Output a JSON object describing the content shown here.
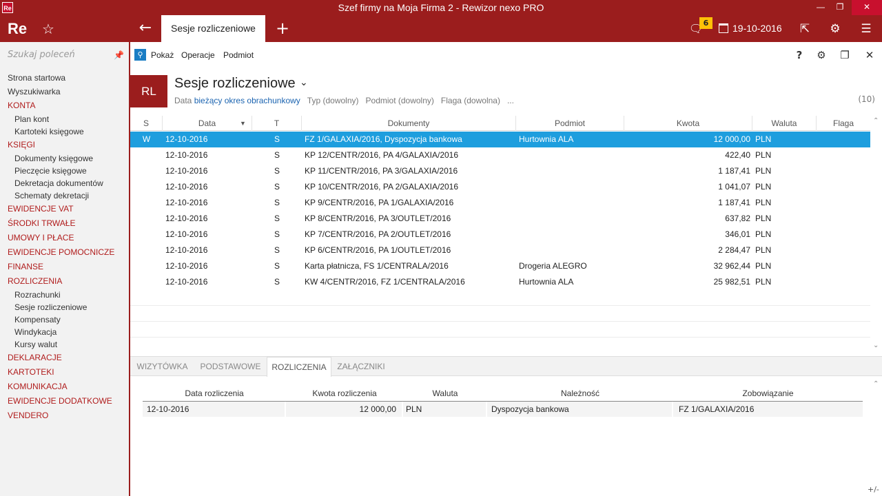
{
  "window": {
    "title": "Szef firmy na Moja Firma 2 - Rewizor nexo PRO",
    "app_icon": "Re"
  },
  "topbar": {
    "logo": "Re",
    "active_tab": "Sesje rozliczeniowe",
    "notifications": "6",
    "date": "19-10-2016"
  },
  "sidebar": {
    "search_placeholder": "Szukaj poleceń",
    "items": [
      {
        "label": "Strona startowa",
        "type": "item"
      },
      {
        "label": "Wyszukiwarka",
        "type": "item"
      },
      {
        "label": "KONTA",
        "type": "section"
      },
      {
        "label": "Plan kont",
        "type": "sub"
      },
      {
        "label": "Kartoteki księgowe",
        "type": "sub"
      },
      {
        "label": "KSIĘGI",
        "type": "section"
      },
      {
        "label": "Dokumenty księgowe",
        "type": "sub"
      },
      {
        "label": "Pieczęcie księgowe",
        "type": "sub"
      },
      {
        "label": "Dekretacja dokumentów",
        "type": "sub"
      },
      {
        "label": "Schematy dekretacji",
        "type": "sub"
      },
      {
        "label": "EWIDENCJE VAT",
        "type": "section"
      },
      {
        "label": "ŚRODKI TRWAŁE",
        "type": "section"
      },
      {
        "label": "UMOWY I PŁACE",
        "type": "section"
      },
      {
        "label": "EWIDENCJE POMOCNICZE",
        "type": "section"
      },
      {
        "label": "FINANSE",
        "type": "section"
      },
      {
        "label": "ROZLICZENIA",
        "type": "section"
      },
      {
        "label": "Rozrachunki",
        "type": "sub"
      },
      {
        "label": "Sesje rozliczeniowe",
        "type": "sub"
      },
      {
        "label": "Kompensaty",
        "type": "sub"
      },
      {
        "label": "Windykacja",
        "type": "sub"
      },
      {
        "label": "Kursy walut",
        "type": "sub"
      },
      {
        "label": "DEKLARACJE",
        "type": "section"
      },
      {
        "label": "KARTOTEKI",
        "type": "section"
      },
      {
        "label": "KOMUNIKACJA",
        "type": "section"
      },
      {
        "label": "EWIDENCJE DODATKOWE",
        "type": "section"
      },
      {
        "label": "VENDERO",
        "type": "section"
      }
    ]
  },
  "toolbar": {
    "show": "Pokaż",
    "operations": "Operacje",
    "subject": "Podmiot"
  },
  "header": {
    "badge": "RL",
    "title": "Sesje rozliczeniowe",
    "filter_date_label": "Data",
    "filter_date_value": "bieżący okres obrachunkowy",
    "filter_type": "Typ (dowolny)",
    "filter_subject": "Podmiot (dowolny)",
    "filter_flag": "Flaga (dowolna)",
    "more": "...",
    "count": "(10)"
  },
  "grid": {
    "columns": [
      "S",
      "Data",
      "T",
      "Dokumenty",
      "Podmiot",
      "Kwota",
      "Waluta",
      "Flaga"
    ],
    "rows": [
      {
        "s": "W",
        "date": "12-10-2016",
        "t": "S",
        "doc": "FZ 1/GALAXIA/2016, Dyspozycja bankowa",
        "subject": "Hurtownia ALA",
        "amount": "12 000,00",
        "currency": "PLN",
        "flag": ""
      },
      {
        "s": "",
        "date": "12-10-2016",
        "t": "S",
        "doc": "KP 12/CENTR/2016, PA 4/GALAXIA/2016",
        "subject": "",
        "amount": "422,40",
        "currency": "PLN",
        "flag": ""
      },
      {
        "s": "",
        "date": "12-10-2016",
        "t": "S",
        "doc": "KP 11/CENTR/2016, PA 3/GALAXIA/2016",
        "subject": "",
        "amount": "1 187,41",
        "currency": "PLN",
        "flag": ""
      },
      {
        "s": "",
        "date": "12-10-2016",
        "t": "S",
        "doc": "KP 10/CENTR/2016, PA 2/GALAXIA/2016",
        "subject": "",
        "amount": "1 041,07",
        "currency": "PLN",
        "flag": ""
      },
      {
        "s": "",
        "date": "12-10-2016",
        "t": "S",
        "doc": "KP 9/CENTR/2016, PA 1/GALAXIA/2016",
        "subject": "",
        "amount": "1 187,41",
        "currency": "PLN",
        "flag": ""
      },
      {
        "s": "",
        "date": "12-10-2016",
        "t": "S",
        "doc": "KP 8/CENTR/2016, PA 3/OUTLET/2016",
        "subject": "",
        "amount": "637,82",
        "currency": "PLN",
        "flag": ""
      },
      {
        "s": "",
        "date": "12-10-2016",
        "t": "S",
        "doc": "KP 7/CENTR/2016, PA 2/OUTLET/2016",
        "subject": "",
        "amount": "346,01",
        "currency": "PLN",
        "flag": ""
      },
      {
        "s": "",
        "date": "12-10-2016",
        "t": "S",
        "doc": "KP 6/CENTR/2016, PA 1/OUTLET/2016",
        "subject": "",
        "amount": "2 284,47",
        "currency": "PLN",
        "flag": ""
      },
      {
        "s": "",
        "date": "12-10-2016",
        "t": "S",
        "doc": "Karta płatnicza, FS 1/CENTRALA/2016",
        "subject": "Drogeria ALEGRO",
        "amount": "32 962,44",
        "currency": "PLN",
        "flag": ""
      },
      {
        "s": "",
        "date": "12-10-2016",
        "t": "S",
        "doc": "KW 4/CENTR/2016, FZ 1/CENTRALA/2016",
        "subject": "Hurtownia ALA",
        "amount": "25 982,51",
        "currency": "PLN",
        "flag": ""
      }
    ]
  },
  "bottom": {
    "tabs": [
      "WIZYTÓWKA",
      "PODSTAWOWE",
      "ROZLICZENIA",
      "ZAŁĄCZNIKI"
    ],
    "active_tab": "ROZLICZENIA",
    "columns": [
      "Data rozliczenia",
      "Kwota rozliczenia",
      "Waluta",
      "Należność",
      "Zobowiązanie"
    ],
    "rows": [
      {
        "date": "12-10-2016",
        "amount": "12 000,00",
        "currency": "PLN",
        "receivable": "Dyspozycja bankowa",
        "liability": "FZ 1/GALAXIA/2016"
      }
    ],
    "plus_minus": "+/-"
  },
  "colors": {
    "brand": "#9b1d1d",
    "selection": "#1e9ede",
    "badge": "#ffc107",
    "link": "#1a63b0"
  }
}
